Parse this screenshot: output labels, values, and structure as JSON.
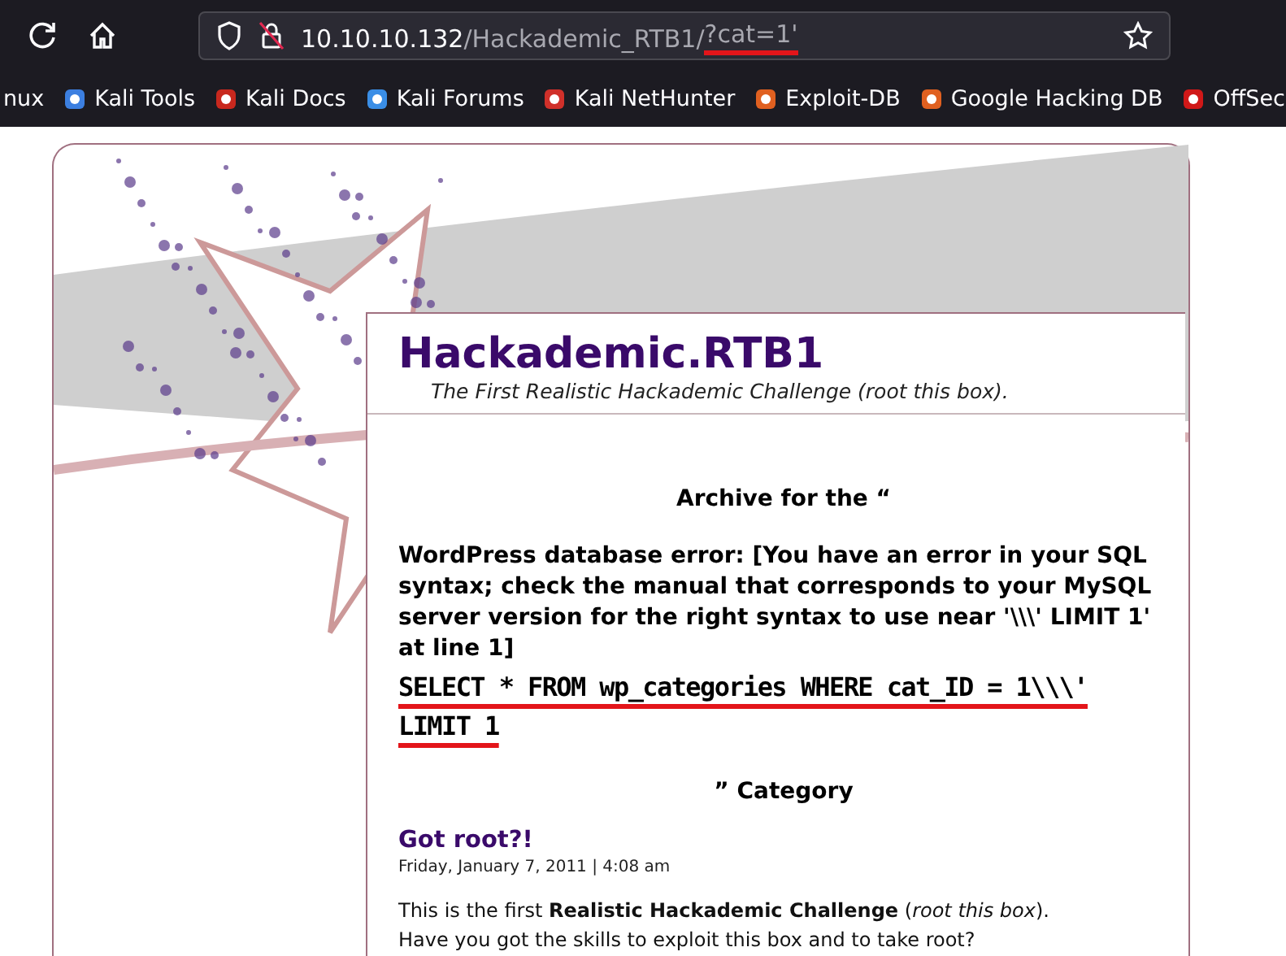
{
  "toolbar": {
    "url_host": "10.10.10.132",
    "url_path": "/Hackademic_RTB1/",
    "url_query": "?cat=1'"
  },
  "bookmarks": [
    {
      "label": "nux"
    },
    {
      "label": "Kali Tools"
    },
    {
      "label": "Kali Docs"
    },
    {
      "label": "Kali Forums"
    },
    {
      "label": "Kali NetHunter"
    },
    {
      "label": "Exploit-DB"
    },
    {
      "label": "Google Hacking DB"
    },
    {
      "label": "OffSec"
    }
  ],
  "blog": {
    "title": "Hackademic.RTB1",
    "tagline": "The First Realistic Hackademic Challenge (root this box).",
    "archive_heading": "Archive for the “",
    "error_message": "WordPress database error: [You have an error in your SQL syntax; check the manual that corresponds to your MySQL server version for the right syntax to use near '\\\\\\' LIMIT 1' at line 1]",
    "sql_query": "SELECT * FROM wp_categories WHERE cat_ID = 1\\\\\\' LIMIT 1",
    "category_heading": "” Category",
    "post": {
      "title": "Got root?!",
      "date": "Friday, January 7, 2011 | 4:08 am",
      "body_lines": [
        "This is the first **Realistic Hackademic Challenge** (*root this box*).",
        "Have you got the skills to exploit this box and to take root?"
      ]
    }
  }
}
